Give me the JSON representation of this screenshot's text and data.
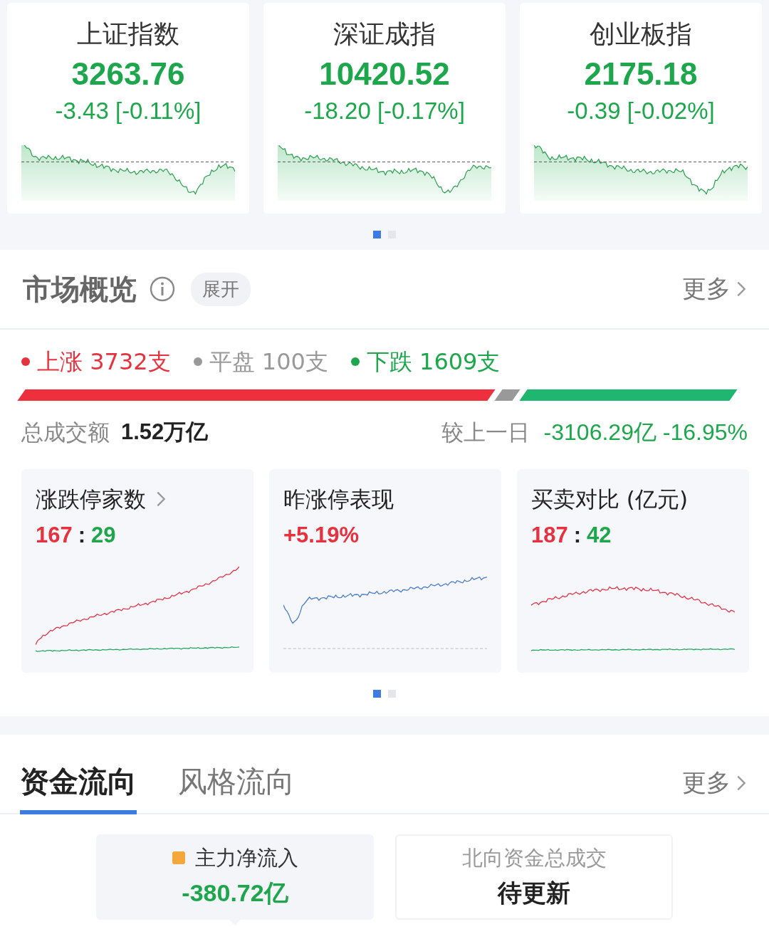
{
  "indices": [
    {
      "name": "上证指数",
      "value": "3263.76",
      "change": "-3.43 [-0.11%]"
    },
    {
      "name": "深证成指",
      "value": "10420.52",
      "change": "-18.20 [-0.17%]"
    },
    {
      "name": "创业板指",
      "value": "2175.18",
      "change": "-0.39 [-0.02%]"
    }
  ],
  "index_pager": [
    {
      "selected": true
    },
    {
      "selected": false
    }
  ],
  "market_overview": {
    "title": "市场概览",
    "expand_label": "展开",
    "more_label": "更多",
    "breadth": [
      {
        "kind": "up",
        "label": "上涨",
        "count": "3732支"
      },
      {
        "kind": "flat",
        "label": "平盘",
        "count": "100支"
      },
      {
        "kind": "down",
        "label": "下跌",
        "count": "1609支"
      }
    ],
    "turnover_label": "总成交额",
    "turnover": "1.52万亿",
    "compare_label": "较上一日",
    "compare_value": "-3106.29亿 -16.95%",
    "cards": [
      {
        "title": "涨跌停家数",
        "has_arrow": true,
        "kind": "dual",
        "figures": [
          {
            "text": "167",
            "color": "#e5323e"
          },
          {
            "text": ":",
            "color": "#222222"
          },
          {
            "text": "29",
            "color": "#1ea64c"
          }
        ]
      },
      {
        "title": "昨涨停表现",
        "has_arrow": false,
        "kind": "single",
        "figures": [
          {
            "text": "+5.19%",
            "color": "#e5323e"
          }
        ]
      },
      {
        "title": "买卖对比 (亿元)",
        "has_arrow": false,
        "kind": "dual_flat",
        "figures": [
          {
            "text": "187",
            "color": "#e5323e"
          },
          {
            "text": ":",
            "color": "#222222"
          },
          {
            "text": "42",
            "color": "#1ea64c"
          }
        ]
      }
    ],
    "pager": [
      {
        "selected": true
      },
      {
        "selected": false
      }
    ]
  },
  "fund_flow": {
    "tabs": [
      {
        "label": "资金流向",
        "selected": true
      },
      {
        "label": "风格流向",
        "selected": false
      }
    ],
    "more_label": "更多",
    "cards": [
      {
        "label": "主力净流入",
        "value": "-380.72亿",
        "kind": "amount",
        "color": "#f5a83a",
        "selected": true
      },
      {
        "label": "北向资金总成交",
        "value": "待更新",
        "kind": "status",
        "selected": false
      }
    ]
  }
}
